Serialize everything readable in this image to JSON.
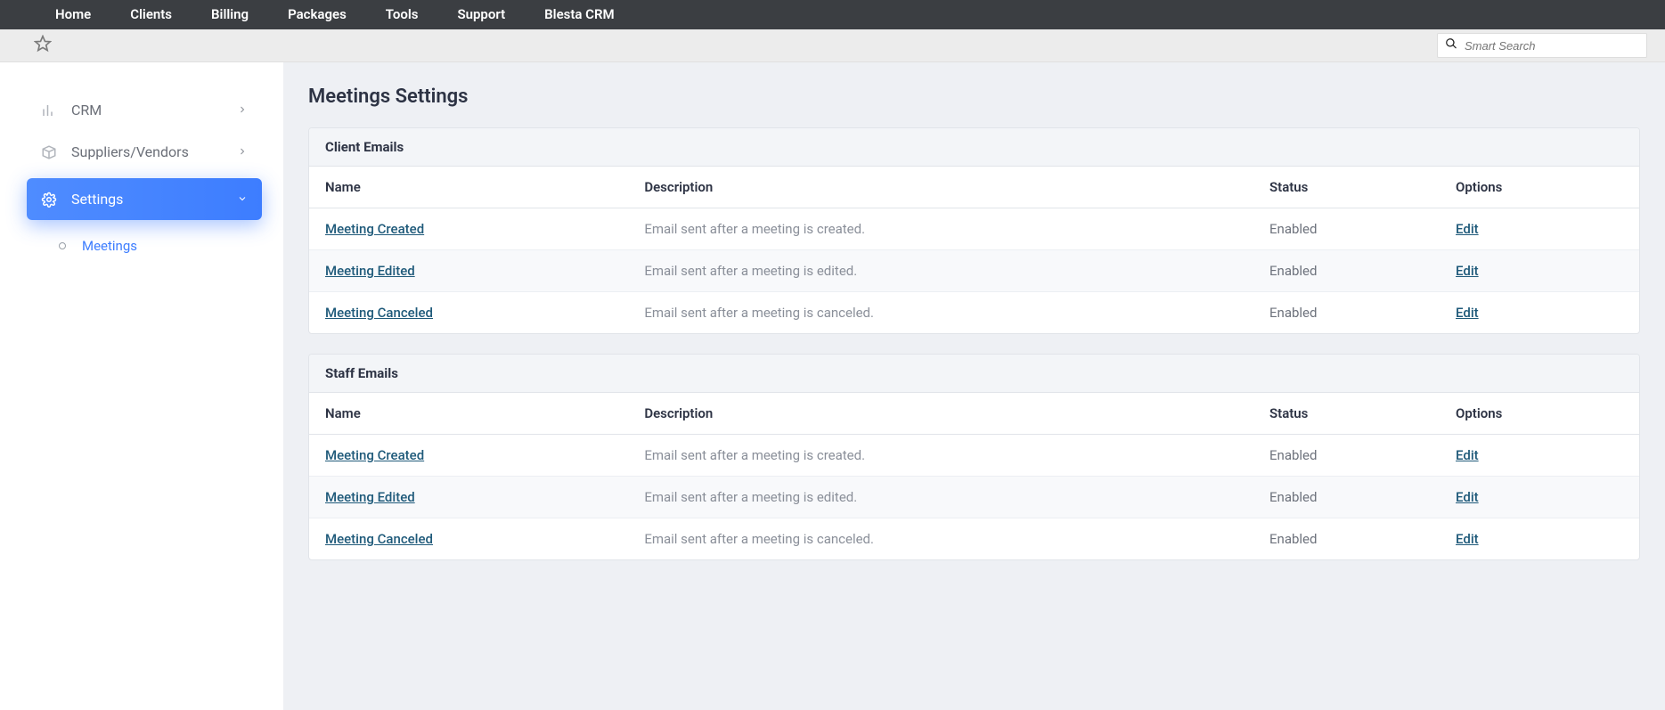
{
  "topnav": {
    "items": [
      "Home",
      "Clients",
      "Billing",
      "Packages",
      "Tools",
      "Support",
      "Blesta CRM"
    ]
  },
  "search": {
    "placeholder": "Smart Search"
  },
  "sidebar": {
    "crm": "CRM",
    "suppliers": "Suppliers/Vendors",
    "settings": "Settings",
    "meetings": "Meetings"
  },
  "page": {
    "title": "Meetings Settings"
  },
  "columns": {
    "name": "Name",
    "description": "Description",
    "status": "Status",
    "options": "Options"
  },
  "sections": [
    {
      "title": "Client Emails",
      "rows": [
        {
          "name": "Meeting Created",
          "desc": "Email sent after a meeting is created.",
          "status": "Enabled",
          "option": "Edit"
        },
        {
          "name": "Meeting Edited",
          "desc": "Email sent after a meeting is edited.",
          "status": "Enabled",
          "option": "Edit"
        },
        {
          "name": "Meeting Canceled",
          "desc": "Email sent after a meeting is canceled.",
          "status": "Enabled",
          "option": "Edit"
        }
      ]
    },
    {
      "title": "Staff Emails",
      "rows": [
        {
          "name": "Meeting Created",
          "desc": "Email sent after a meeting is created.",
          "status": "Enabled",
          "option": "Edit"
        },
        {
          "name": "Meeting Edited",
          "desc": "Email sent after a meeting is edited.",
          "status": "Enabled",
          "option": "Edit"
        },
        {
          "name": "Meeting Canceled",
          "desc": "Email sent after a meeting is canceled.",
          "status": "Enabled",
          "option": "Edit"
        }
      ]
    }
  ]
}
